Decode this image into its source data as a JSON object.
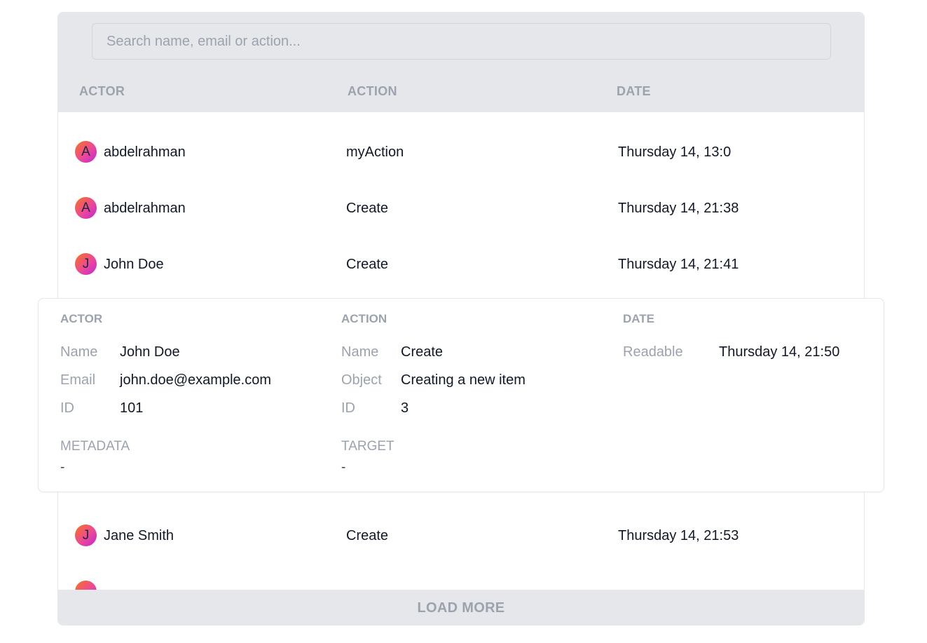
{
  "search": {
    "placeholder": "Search name, email or action..."
  },
  "columns": {
    "actor": "ACTOR",
    "action": "ACTION",
    "date": "DATE"
  },
  "rows": [
    {
      "initial": "A",
      "actor": "abdelrahman",
      "action": "myAction",
      "date": "Thursday 14, 13:0"
    },
    {
      "initial": "A",
      "actor": "abdelrahman",
      "action": "Create",
      "date": "Thursday 14, 21:38"
    },
    {
      "initial": "J",
      "actor": "John Doe",
      "action": "Create",
      "date": "Thursday 14, 21:41"
    },
    {
      "initial": "J",
      "actor": "Jane Smith",
      "action": "Create",
      "date": "Thursday 14, 21:53"
    }
  ],
  "detail": {
    "actor": {
      "heading": "ACTOR",
      "name_label": "Name",
      "name": "John Doe",
      "email_label": "Email",
      "email": "john.doe@example.com",
      "id_label": "ID",
      "id": "101",
      "metadata_label": "METADATA",
      "metadata": "-"
    },
    "action": {
      "heading": "ACTION",
      "name_label": "Name",
      "name": "Create",
      "object_label": "Object",
      "object": "Creating a new item",
      "id_label": "ID",
      "id": "3",
      "target_label": "TARGET",
      "target": "-"
    },
    "date": {
      "heading": "DATE",
      "readable_label": "Readable",
      "readable": "Thursday 14, 21:50"
    }
  },
  "footer": {
    "load_more_label": "LOAD MORE"
  },
  "colors": {
    "header_bg": "#e5e7eb",
    "muted_text": "#9ca3af",
    "avatar_gradient_start": "#f97316",
    "avatar_gradient_end": "#c026d3"
  },
  "icons": {
    "avatar": "avatar-initial-circle"
  }
}
